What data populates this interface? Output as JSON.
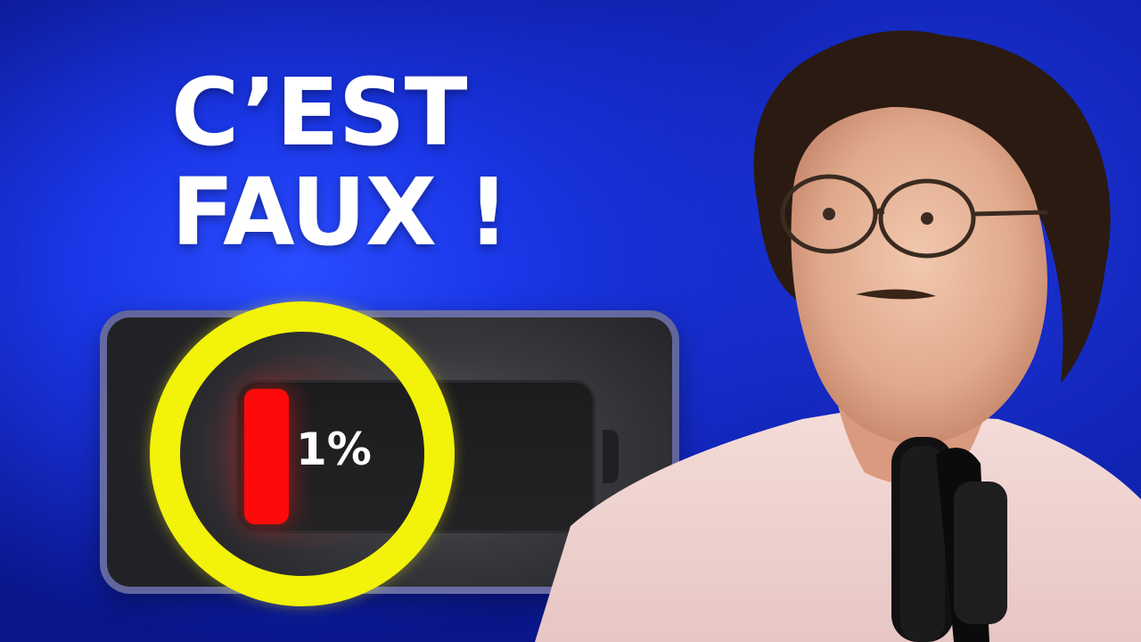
{
  "headline": {
    "line1": "C’EST",
    "line2": "FAUX !"
  },
  "battery": {
    "percent_label": "1%",
    "level": 0.01,
    "fill_color": "#ff0a0a"
  },
  "colors": {
    "background": "#1a36e6",
    "highlight_ring": "#f2f20a",
    "text": "#ffffff"
  },
  "icons": {
    "battery": "battery-icon",
    "highlight": "circle-highlight",
    "microphone": "microphone-icon"
  }
}
